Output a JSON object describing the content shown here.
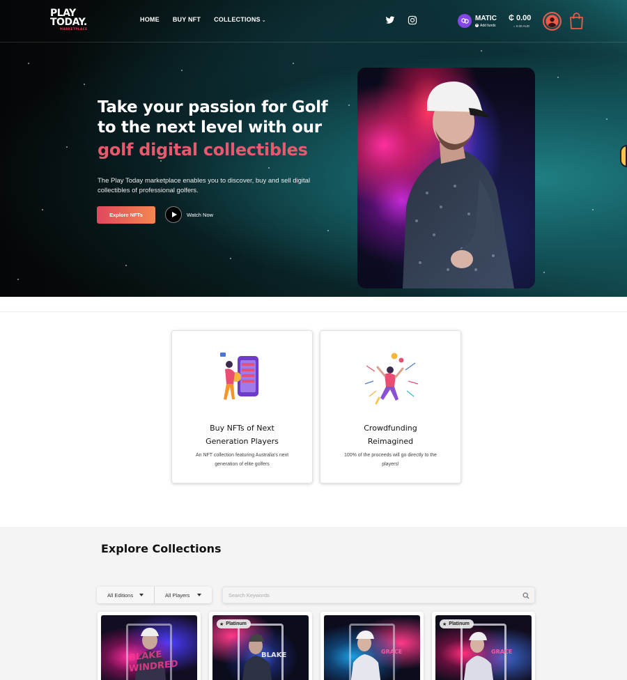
{
  "brand": {
    "logo_line1": "PLAY",
    "logo_line2": "TODAY.",
    "logo_sub": "MARKETPLACE"
  },
  "nav": {
    "items": [
      {
        "label": "HOME"
      },
      {
        "label": "BUY NFT"
      },
      {
        "label": "COLLECTIONS",
        "has_dropdown": true
      }
    ]
  },
  "social": [
    {
      "icon": "twitter-icon"
    },
    {
      "icon": "instagram-icon"
    }
  ],
  "wallet": {
    "currency": "MATIC",
    "add_funds": "Add funds",
    "balance": "₵ 0.00",
    "balance_fiat": "= 0.00 AUD"
  },
  "hero": {
    "title": "Take your passion for Golf to the next level with our",
    "accent": "golf digital collectibles",
    "subtitle": "The Play Today marketplace enables you to discover, buy and sell digital collectibles of professional golfers.",
    "cta_label": "Explore NFTs",
    "watch_label": "Watch Now"
  },
  "features": [
    {
      "title": "Buy NFTs of Next Generation Players",
      "description": "An NFT collection featuring Australia's next generation of elite golfers"
    },
    {
      "title": "Crowdfunding Reimagined",
      "description": "100% of the proceeds will go directly to the players!"
    }
  ],
  "collections": {
    "title": "Explore Collections",
    "filters": [
      {
        "label": "All Editions"
      },
      {
        "label": "All Players"
      }
    ],
    "search_placeholder": "Search Keywords",
    "cards": [
      {
        "badge": "",
        "name_art": "BLAKE WINDRED"
      },
      {
        "badge": "Platinum",
        "name_art": "BLAKE"
      },
      {
        "badge": "",
        "name_art": "GRACE"
      },
      {
        "badge": "Platinum",
        "name_art": "GRACE"
      }
    ]
  },
  "colors": {
    "accent": "#e45b6e",
    "cta_start": "#e0485e",
    "cta_end": "#f2874f",
    "matic": "#8247e5"
  }
}
